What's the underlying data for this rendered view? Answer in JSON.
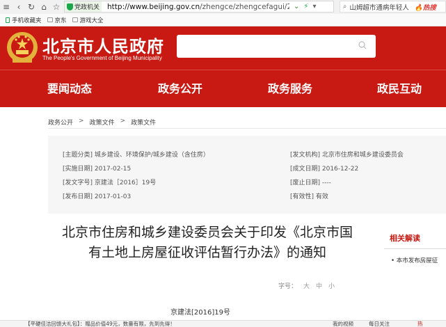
{
  "browser": {
    "tab_chip": "党政机关",
    "url_host": "http://www.beijing.gov.cn",
    "url_path": "/zhengce/zhengcefagui/20",
    "search_query": "山姆超市通病年轻人",
    "hot_label": "热搜",
    "bookmarks": [
      "手机收藏夹",
      "京东",
      "游戏大全"
    ]
  },
  "site": {
    "title_cn": "北京市人民政府",
    "title_en": "The People's Government of Beijing Municipality",
    "search_placeholder": "",
    "nav": [
      "要闻动态",
      "政务公开",
      "政务服务",
      "政民互动"
    ]
  },
  "breadcrumb": [
    "政务公开",
    ">",
    "政策文件",
    ">",
    "政策文件"
  ],
  "meta": {
    "topic": "[主题分类] 城乡建设、环境保护/城乡建设（含住房）",
    "issuer": "[发文机构] 北京市住房和城乡建设委员会",
    "effective": "[实施日期] 2017-02-15",
    "formed": "[成文日期] 2016-12-22",
    "doc_number": "[发文字号] 京建法［2016］19号",
    "repeal": "[废止日期] ----",
    "published": "[发布日期] 2017-01-03",
    "validity": "[有效性] 有效"
  },
  "article": {
    "title_line1": "北京市住房和城乡建设委员会关于印发《北京市国",
    "title_line2": "有土地上房屋征收评估暂行办法》的通知",
    "fontsize_label": "字号：",
    "fontsize_options": [
      "大",
      "中",
      "小"
    ],
    "doc_no": "京建法[2016]19号"
  },
  "side": {
    "heading": "相关解读",
    "item": "• 本市发布房屋征"
  },
  "bottom_bar": {
    "ad": "【平硬佳洁回馈大礼包】：赠品价值49元，数量有限，先到先得！",
    "r1": "我的视频",
    "r2": "每日关注",
    "r3": "热"
  },
  "colors": {
    "brand_red": "#c81a12",
    "meta_bg": "#f6f6f6"
  }
}
